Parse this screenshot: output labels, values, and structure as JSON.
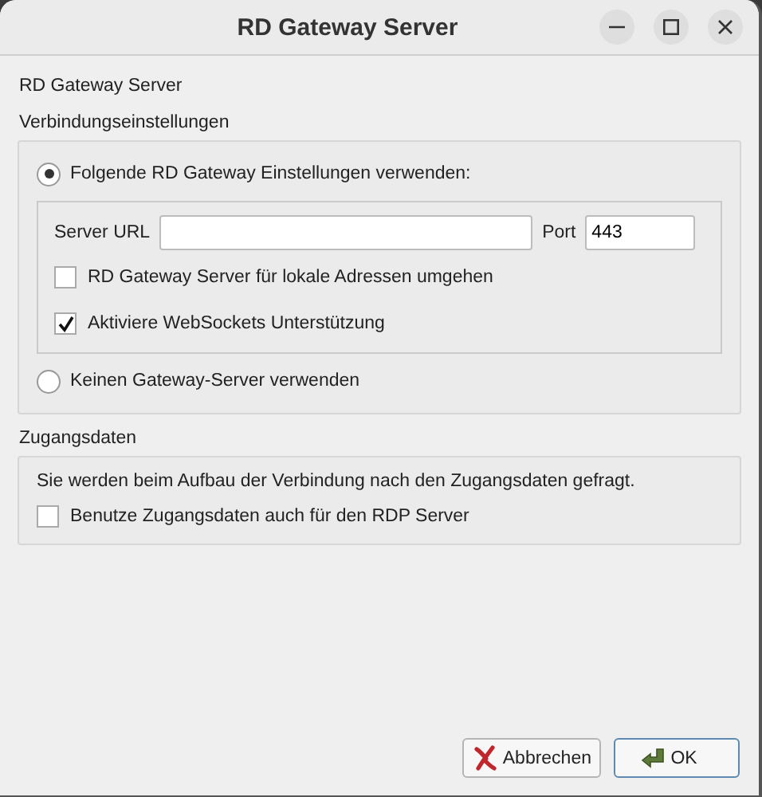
{
  "window": {
    "title": "RD Gateway Server"
  },
  "heading": "RD Gateway Server",
  "connection": {
    "title": "Verbindungseinstellungen",
    "options": [
      {
        "label": "Folgende RD Gateway Einstellungen verwenden:",
        "selected": true
      },
      {
        "label": "Keinen Gateway-Server verwenden",
        "selected": false
      }
    ],
    "server_url": {
      "label": "Server URL"
    },
    "port": {
      "label": "Port",
      "value": "443"
    },
    "checks": [
      {
        "label": "RD Gateway Server für lokale Adressen umgehen",
        "checked": false
      },
      {
        "label": "Aktiviere WebSockets Unterstützung",
        "checked": true
      }
    ]
  },
  "credentials": {
    "title": "Zugangsdaten",
    "note": "Sie werden beim Aufbau der Verbindung nach den Zugangsdaten gefragt.",
    "checks": [
      {
        "label": "Benutze Zugangsdaten auch für den RDP Server",
        "checked": false
      }
    ]
  },
  "buttons": [
    {
      "kind": "cancel",
      "label": "Abbrechen"
    },
    {
      "kind": "ok",
      "label": "OK"
    }
  ]
}
